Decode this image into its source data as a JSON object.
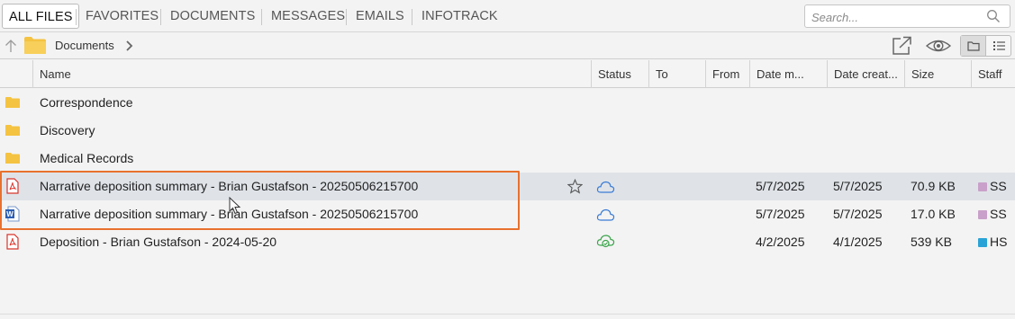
{
  "tabs": [
    {
      "label": "ALL FILES",
      "active": true
    },
    {
      "label": "FAVORITES",
      "active": false
    },
    {
      "label": "DOCUMENTS",
      "active": false
    },
    {
      "label": "MESSAGES",
      "active": false
    },
    {
      "label": "EMAILS",
      "active": false
    },
    {
      "label": "INFOTRACK",
      "active": false
    }
  ],
  "search": {
    "placeholder": "Search..."
  },
  "breadcrumb": {
    "folder": "Documents"
  },
  "columns": {
    "name": "Name",
    "status": "Status",
    "to": "To",
    "from": "From",
    "date_modified": "Date m...",
    "date_created": "Date creat...",
    "size": "Size",
    "staff": "Staff"
  },
  "rows": [
    {
      "type": "folder",
      "name": "Correspondence"
    },
    {
      "type": "folder",
      "name": "Discovery"
    },
    {
      "type": "folder",
      "name": "Medical Records"
    },
    {
      "type": "pdf",
      "name": "Narrative deposition summary - Brian Gustafson - 20250506215700",
      "status": "cloud",
      "date_modified": "5/7/2025",
      "date_created": "5/7/2025",
      "size": "70.9 KB",
      "staff": "SS",
      "staff_color": "#c9a0c9"
    },
    {
      "type": "word",
      "name": "Narrative deposition summary - Brian Gustafson - 20250506215700",
      "status": "cloud",
      "date_modified": "5/7/2025",
      "date_created": "5/7/2025",
      "size": "17.0 KB",
      "staff": "SS",
      "staff_color": "#c9a0c9"
    },
    {
      "type": "pdf",
      "name": "Deposition - Brian Gustafson - 2024-05-20",
      "status": "cloud-synced",
      "date_modified": "4/2/2025",
      "date_created": "4/1/2025",
      "size": "539 KB",
      "staff": "HS",
      "staff_color": "#29a3d6"
    }
  ],
  "colors": {
    "folder": "#f5c342",
    "pdf": "#d9342b",
    "word": "#2b5fb3",
    "cloud": "#3a7bd5",
    "cloud_synced": "#3aa34a",
    "highlight": "#e8712d",
    "hover_row": "#dfe3e8"
  }
}
